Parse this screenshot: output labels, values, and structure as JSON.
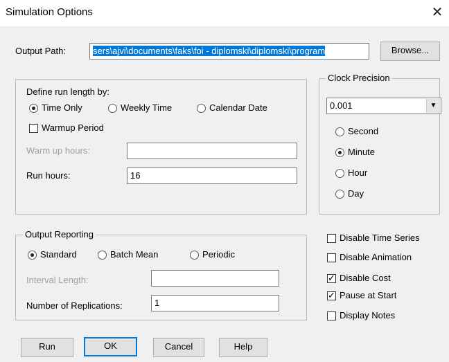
{
  "window": {
    "title": "Simulation Options",
    "close_icon": "close-icon"
  },
  "output_path": {
    "label": "Output Path:",
    "value": "sers\\ajvi\\documents\\faks\\foi - diplomski\\diplomski\\program",
    "browse_label": "Browse..."
  },
  "run_length": {
    "group_label": "Define run length by:",
    "options": [
      "Time Only",
      "Weekly Time",
      "Calendar Date"
    ],
    "selected": "Time Only",
    "warmup_label": "Warmup Period",
    "warmup_checked": false,
    "warmup_hours_label": "Warm up hours:",
    "warmup_hours_value": "",
    "run_hours_label": "Run hours:",
    "run_hours_value": "16"
  },
  "clock_precision": {
    "group_label": "Clock Precision",
    "selected_value": "0.001",
    "options": [
      "Second",
      "Minute",
      "Hour",
      "Day"
    ],
    "selected_unit": "Minute"
  },
  "output_reporting": {
    "group_label": "Output Reporting",
    "options": [
      "Standard",
      "Batch Mean",
      "Periodic"
    ],
    "selected": "Standard",
    "interval_length_label": "Interval Length:",
    "interval_length_value": "",
    "replications_label": "Number of Replications:",
    "replications_value": "1"
  },
  "flags": [
    {
      "label": "Disable Time Series",
      "checked": false
    },
    {
      "label": "Disable Animation",
      "checked": false
    },
    {
      "label": "Disable Cost",
      "checked": true
    },
    {
      "label": "Pause at Start",
      "checked": true
    },
    {
      "label": "Display Notes",
      "checked": false
    }
  ],
  "buttons": {
    "run": "Run",
    "ok": "OK",
    "cancel": "Cancel",
    "help": "Help"
  }
}
